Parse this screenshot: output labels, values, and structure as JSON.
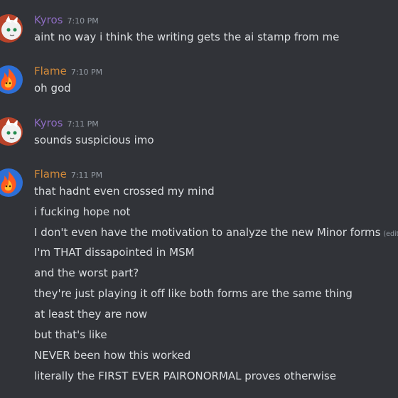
{
  "colors": {
    "background": "#313338",
    "text": "#dbdee1",
    "muted": "#949ba4",
    "kyros": "#8e6cc3",
    "flame": "#d28a3a"
  },
  "messages": [
    {
      "author": "Kyros",
      "time": "7:10 PM",
      "avatar_icon": "white-fox-avatar-icon",
      "lines": [
        "aint no way i think the writing gets the ai stamp from me"
      ]
    },
    {
      "author": "Flame",
      "time": "7:10 PM",
      "avatar_icon": "flame-avatar-icon",
      "lines": [
        "oh god"
      ]
    },
    {
      "author": "Kyros",
      "time": "7:11 PM",
      "avatar_icon": "white-fox-avatar-icon",
      "lines": [
        "sounds suspicious imo"
      ]
    },
    {
      "author": "Flame",
      "time": "7:11 PM",
      "avatar_icon": "flame-avatar-icon",
      "lines": [
        "that hadnt even crossed my mind",
        "i fucking hope not",
        "I don't even have the motivation to analyze the new Minor forms",
        "I'm THAT dissapointed in MSM",
        "and the worst part?",
        "they're just playing it off like both forms are the same thing",
        "at least they are now",
        "but that's like",
        "NEVER been how this worked",
        "literally the FIRST EVER PAIRONORMAL proves otherwise"
      ],
      "edited_label": "(edited)"
    }
  ]
}
